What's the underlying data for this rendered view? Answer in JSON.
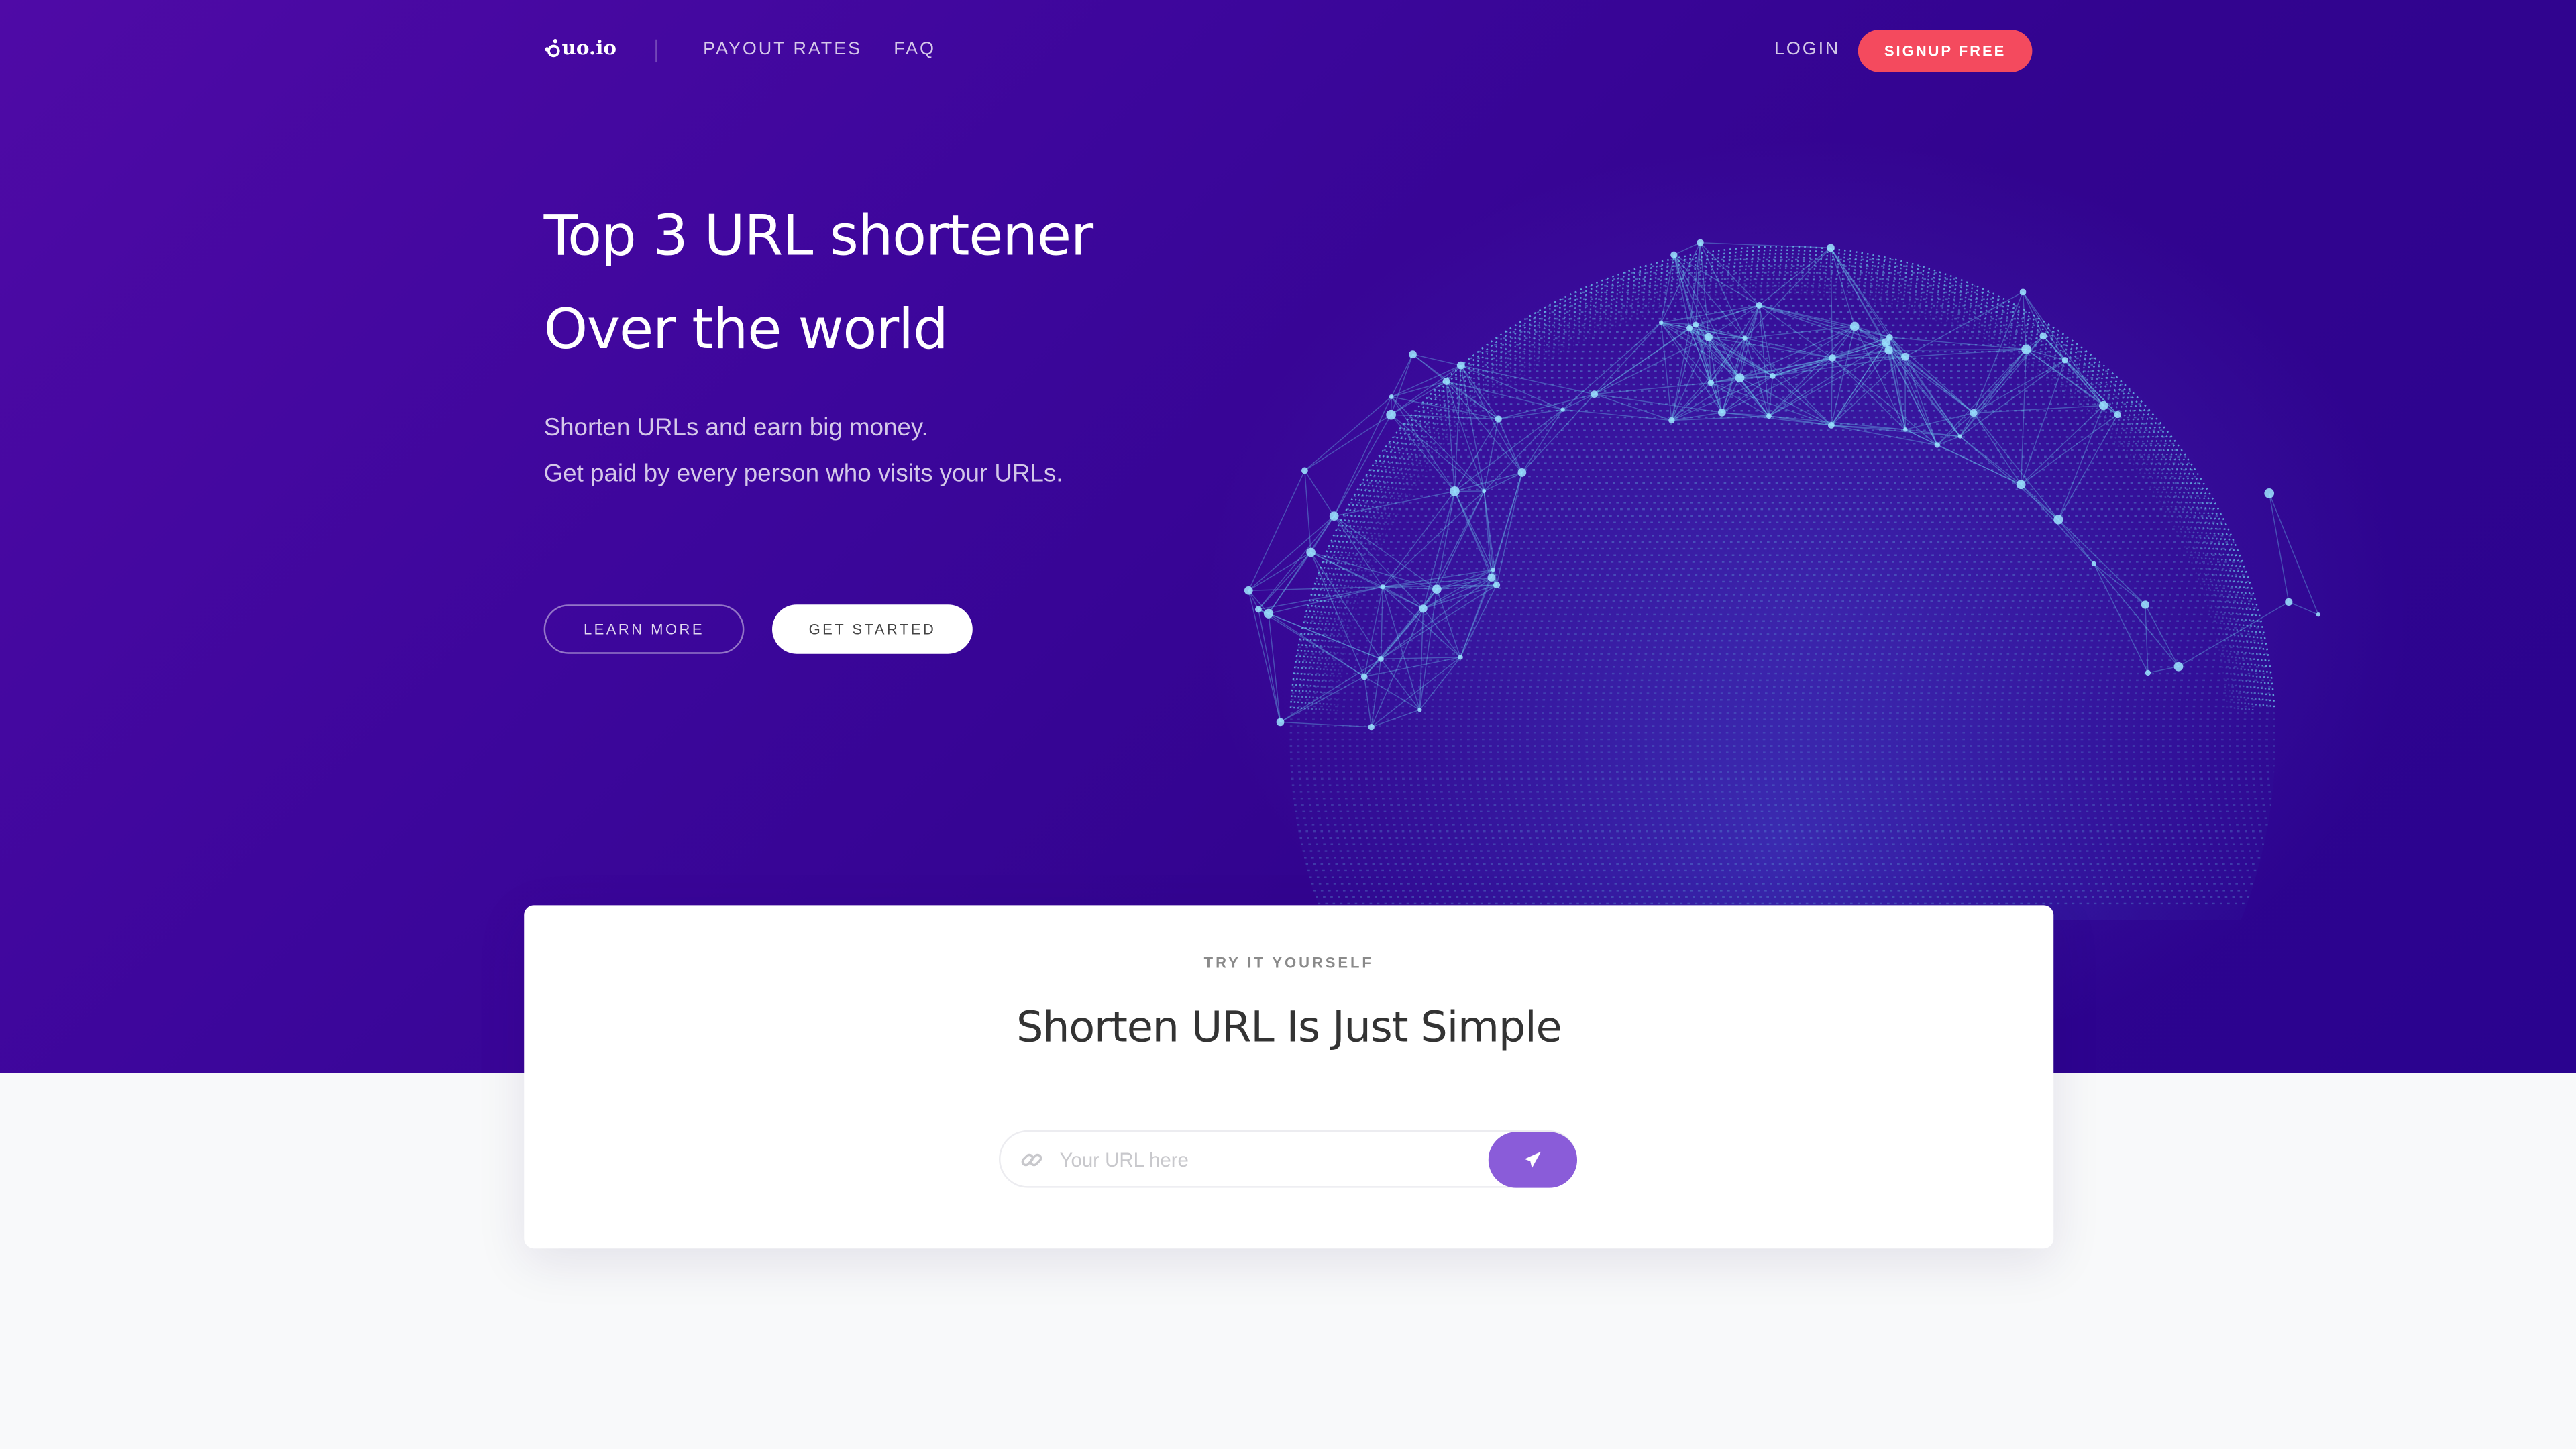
{
  "brand": {
    "name": "uo.io"
  },
  "nav": {
    "payout_rates": "PAYOUT RATES",
    "faq": "FAQ",
    "login": "LOGIN",
    "signup": "SIGNUP FREE"
  },
  "hero": {
    "title_line1": "Top 3 URL shortener",
    "title_line2": "Over the world",
    "subtitle_line1": "Shorten URLs and earn big money.",
    "subtitle_line2": "Get paid by every person who visits your URLs.",
    "learn_more": "LEARN MORE",
    "get_started": "GET STARTED"
  },
  "shortener": {
    "eyebrow": "TRY IT YOURSELF",
    "title": "Shorten URL Is Just Simple",
    "input_placeholder": "Your URL here",
    "input_value": ""
  },
  "colors": {
    "hero_bg": "#3c069b",
    "signup_bg": "#f44a5e",
    "submit_bg": "#8a5cd9",
    "globe": "#6fd3f0"
  },
  "icons": {
    "logo": "logo-icon",
    "link": "link-icon",
    "send": "paper-plane-icon",
    "globe": "globe-network-illustration"
  }
}
